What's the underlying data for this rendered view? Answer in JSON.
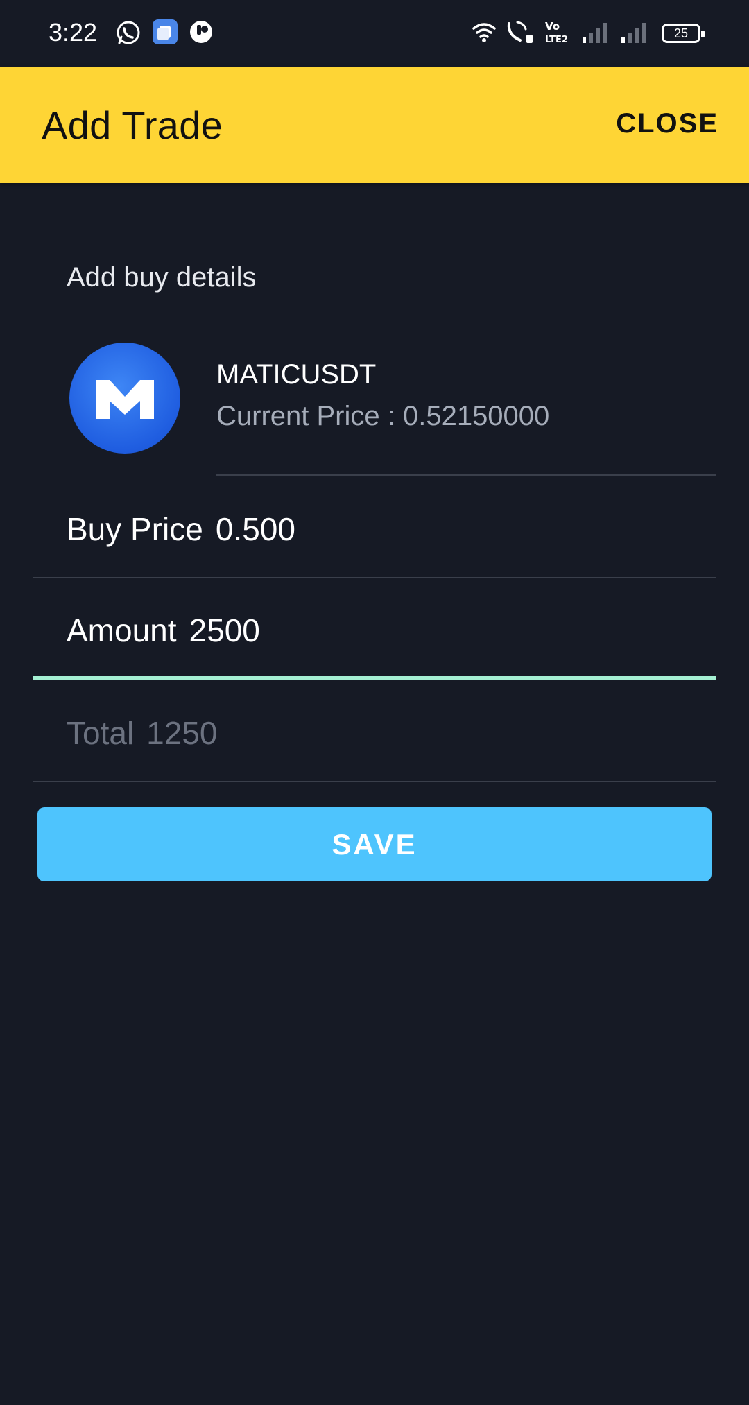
{
  "status_bar": {
    "time": "3:22",
    "battery": "25",
    "icons": [
      "whatsapp-icon",
      "app-notification-icon",
      "app-notification-icon",
      "wifi-icon",
      "wifi-calling-icon",
      "volte-icon",
      "signal-icon",
      "signal-icon",
      "battery-icon"
    ]
  },
  "app_bar": {
    "title": "Add Trade",
    "close_label": "CLOSE",
    "background": "#fed535"
  },
  "form": {
    "heading": "Add buy details",
    "coin": {
      "symbol": "MATICUSDT",
      "current_price": "Current Price : 0.52150000",
      "logo_color": "#1f5de0"
    },
    "buy_price": {
      "label": "Buy Price",
      "value": "0.500"
    },
    "amount": {
      "label": "Amount",
      "value": "2500",
      "focused": true
    },
    "total": {
      "label": "Total",
      "value": "1250",
      "enabled": false
    },
    "save_label": "SAVE",
    "accent": "#4ec4fd",
    "focus_color": "#a5f0d3"
  },
  "theme": {
    "background": "#161a25"
  }
}
